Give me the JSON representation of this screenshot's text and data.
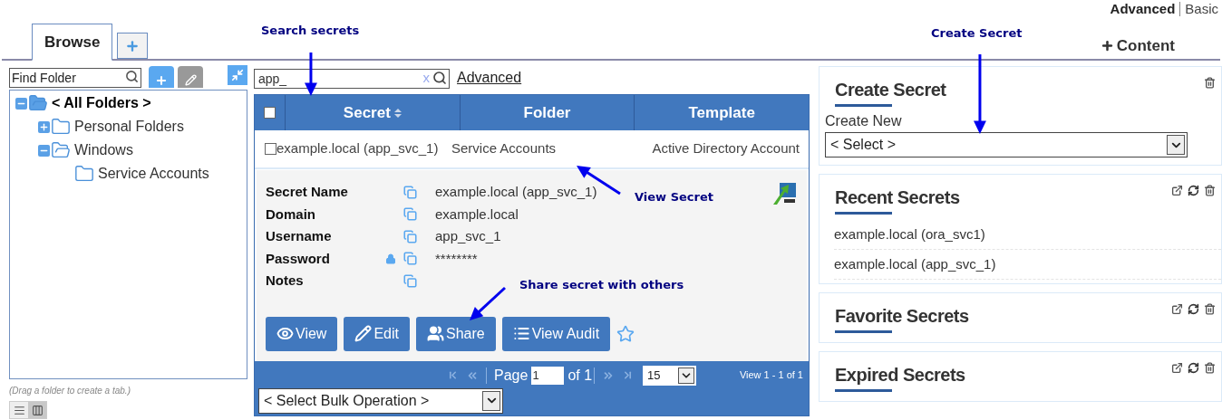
{
  "tabs": [
    {
      "label": "Browse",
      "selected": true
    }
  ],
  "view_modes": [
    {
      "label": "Advanced",
      "selected": true
    },
    {
      "label": "Basic",
      "selected": false
    }
  ],
  "add_content": "Content",
  "folder_search": {
    "placeholder": "Find Folder"
  },
  "tree": [
    {
      "label": "< All Folders >",
      "selected": true,
      "expanded": true,
      "children": [
        {
          "label": "Personal Folders",
          "selected": false,
          "expanded": false
        },
        {
          "label": "Windows",
          "selected": false,
          "expanded": true,
          "children": [
            {
              "label": "Service Accounts",
              "selected": false
            }
          ]
        }
      ]
    }
  ],
  "hint": "(Drag a folder to create a tab.)",
  "layouts": [
    {
      "kind": "list",
      "selected": false
    },
    {
      "kind": "columns",
      "selected": true
    }
  ],
  "search": {
    "value": "app_",
    "clear": "x",
    "advanced_link": "Advanced"
  },
  "table": {
    "select_all": false,
    "columns": [
      {
        "label": "Secret",
        "sortable": true
      },
      {
        "label": "Folder",
        "sortable": false
      },
      {
        "label": "Template",
        "sortable": false
      }
    ],
    "rows": [
      {
        "checked": false,
        "cells": [
          "example.local (app_svc_1)",
          "Service Accounts",
          "Active Directory Account"
        ]
      }
    ]
  },
  "details": {
    "fields": [
      {
        "label": "Secret Name",
        "value": "example.local (app_svc_1)",
        "locked": false
      },
      {
        "label": "Domain",
        "value": "example.local",
        "locked": false
      },
      {
        "label": "Username",
        "value": "app_svc_1",
        "locked": false
      },
      {
        "label": "Password",
        "value": "********",
        "locked": true
      },
      {
        "label": "Notes",
        "locked": false
      }
    ],
    "buttons": [
      {
        "kind": "view",
        "label": "View"
      },
      {
        "kind": "edit",
        "label": "Edit"
      },
      {
        "kind": "share",
        "label": "Share"
      },
      {
        "kind": "audit",
        "label": "View Audit"
      }
    ],
    "favorite": false
  },
  "pager": {
    "page_label": "Page",
    "page": "1",
    "of": "of 1",
    "page_size": "15",
    "range": "View 1 - 1 of 1"
  },
  "bulk_operation": "< Select Bulk Operation >",
  "widgets": [
    {
      "kind": "create",
      "title": "Create Secret",
      "field_label": "Create New",
      "select": "< Select >"
    },
    {
      "kind": "list",
      "title": "Recent Secrets",
      "items": [
        "example.local (ora_svc1)",
        "example.local (app_svc_1)"
      ]
    },
    {
      "kind": "list",
      "title": "Favorite Secrets"
    },
    {
      "kind": "list",
      "title": "Expired Secrets"
    }
  ],
  "annotations": [
    {
      "text": "Search secrets"
    },
    {
      "text": "View Secret"
    },
    {
      "text": "Share secret with others"
    },
    {
      "text": "Create Secret"
    }
  ]
}
